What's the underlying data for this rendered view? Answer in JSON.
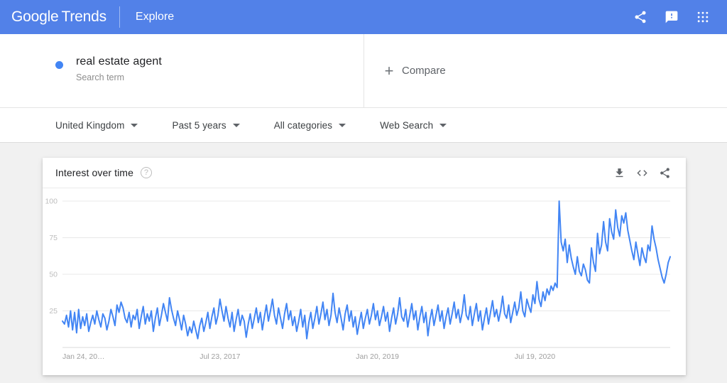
{
  "appbar": {
    "brand_google": "Google",
    "brand_trends": "Trends",
    "explore": "Explore",
    "icons": {
      "share": "share-icon",
      "feedback": "feedback-icon",
      "apps": "apps-grid-icon"
    }
  },
  "query": {
    "term": "real estate agent",
    "term_type": "Search term",
    "term_color": "#4285f4",
    "compare_label": "Compare",
    "compare_plus": "+"
  },
  "filters": [
    {
      "label": "United Kingdom",
      "name": "location"
    },
    {
      "label": "Past 5 years",
      "name": "time-range"
    },
    {
      "label": "All categories",
      "name": "category"
    },
    {
      "label": "Web Search",
      "name": "search-type"
    }
  ],
  "card": {
    "title": "Interest over time",
    "help": "?",
    "actions": [
      {
        "name": "download-csv-icon"
      },
      {
        "name": "embed-code-icon"
      },
      {
        "name": "share-icon"
      }
    ]
  },
  "chart_data": {
    "type": "line",
    "title": "Interest over time",
    "xlabel": "",
    "ylabel": "",
    "ylim": [
      0,
      100
    ],
    "grid": true,
    "legend": false,
    "line_color": "#4285f4",
    "y_ticks": [
      100,
      75,
      50,
      25
    ],
    "x_ticks": [
      {
        "label": "Jan 24, 20…",
        "index": 0
      },
      {
        "label": "Jul 23, 2017",
        "index": 78
      },
      {
        "label": "Jan 20, 2019",
        "index": 156
      },
      {
        "label": "Jul 19, 2020",
        "index": 234
      }
    ],
    "series": [
      {
        "name": "real estate agent",
        "values": [
          18,
          16,
          22,
          14,
          25,
          12,
          24,
          10,
          26,
          13,
          21,
          15,
          23,
          11,
          17,
          22,
          16,
          25,
          19,
          14,
          23,
          20,
          12,
          18,
          26,
          21,
          15,
          29,
          24,
          31,
          27,
          20,
          17,
          24,
          14,
          22,
          19,
          26,
          13,
          21,
          28,
          16,
          23,
          18,
          25,
          11,
          20,
          27,
          15,
          22,
          30,
          24,
          18,
          34,
          26,
          20,
          15,
          25,
          19,
          12,
          22,
          16,
          8,
          14,
          10,
          18,
          12,
          6,
          15,
          20,
          11,
          17,
          24,
          13,
          21,
          27,
          16,
          22,
          33,
          25,
          18,
          28,
          20,
          14,
          24,
          11,
          19,
          26,
          15,
          22,
          18,
          7,
          16,
          23,
          13,
          20,
          27,
          17,
          24,
          12,
          21,
          29,
          18,
          25,
          33,
          22,
          16,
          27,
          20,
          13,
          23,
          30,
          19,
          25,
          15,
          21,
          11,
          18,
          26,
          14,
          22,
          6,
          17,
          24,
          13,
          20,
          28,
          16,
          23,
          31,
          19,
          26,
          15,
          22,
          37,
          24,
          17,
          27,
          20,
          12,
          23,
          29,
          18,
          25,
          14,
          21,
          9,
          17,
          24,
          13,
          20,
          26,
          16,
          22,
          30,
          19,
          25,
          15,
          21,
          28,
          18,
          24,
          11,
          20,
          27,
          16,
          23,
          34,
          21,
          18,
          26,
          14,
          22,
          30,
          19,
          25,
          12,
          21,
          28,
          17,
          24,
          8,
          19,
          26,
          15,
          22,
          29,
          18,
          25,
          13,
          21,
          27,
          16,
          23,
          31,
          20,
          26,
          17,
          24,
          36,
          22,
          19,
          28,
          15,
          23,
          30,
          18,
          25,
          12,
          20,
          27,
          16,
          24,
          32,
          21,
          26,
          18,
          25,
          35,
          23,
          20,
          29,
          17,
          24,
          31,
          22,
          27,
          38,
          25,
          21,
          33,
          28,
          24,
          36,
          30,
          45,
          33,
          28,
          38,
          32,
          40,
          36,
          42,
          39,
          44,
          41,
          100,
          72,
          66,
          74,
          58,
          70,
          61,
          55,
          50,
          62,
          52,
          49,
          57,
          53,
          46,
          44,
          68,
          58,
          52,
          78,
          64,
          70,
          86,
          72,
          66,
          88,
          79,
          74,
          94,
          82,
          76,
          90,
          85,
          92,
          80,
          73,
          66,
          60,
          72,
          64,
          56,
          68,
          62,
          58,
          70,
          66,
          83,
          74,
          68,
          60,
          54,
          48,
          44,
          50,
          58,
          62
        ]
      }
    ]
  }
}
